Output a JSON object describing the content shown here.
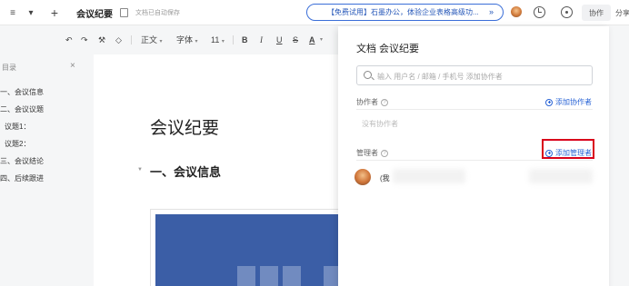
{
  "topbar": {
    "menu_label": "≡",
    "dropdown_label": "▾",
    "add_label": "+",
    "doc_title": "会议纪要",
    "autosave_text": "文档已自动保存",
    "promo_text": "【免费试用】石墨办公，体验企业表格高级功...",
    "promo_arrow": "»",
    "collab_label": "协作",
    "share_label": "分享"
  },
  "format_toolbar": {
    "undo": "↶",
    "redo": "↷",
    "format_painter": "⚒",
    "clear_format": "◇",
    "paragraph_style": "正文",
    "font_family": "字体",
    "font_size": "11",
    "bold": "B",
    "italic": "I",
    "underline": "U",
    "strikethrough": "S",
    "text_color": "A"
  },
  "outline": {
    "title": "目录",
    "close": "×",
    "items": [
      {
        "label": "一、会议信息"
      },
      {
        "label": "二、会议议题"
      },
      {
        "label": "议题1："
      },
      {
        "label": "议题2："
      },
      {
        "label": "三、会议结论"
      },
      {
        "label": "四、后续跟进"
      }
    ]
  },
  "document": {
    "title": "会议纪要",
    "section_heading": "一、会议信息",
    "collapse_arrow": "▼"
  },
  "panel": {
    "title": "文档 会议纪要",
    "search_placeholder": "输入 用户名 / 邮箱 / 手机号 添加协作者",
    "collaborators_label": "协作者",
    "help_glyph": "?",
    "add_collaborator": "添加协作者",
    "no_collaborators": "没有协作者",
    "managers_label": "管理者",
    "add_manager": "添加管理者",
    "member_name": "(我"
  },
  "colors": {
    "accent": "#2a64d6",
    "highlight": "#d9001b",
    "image_bg": "#3b5ea6"
  }
}
